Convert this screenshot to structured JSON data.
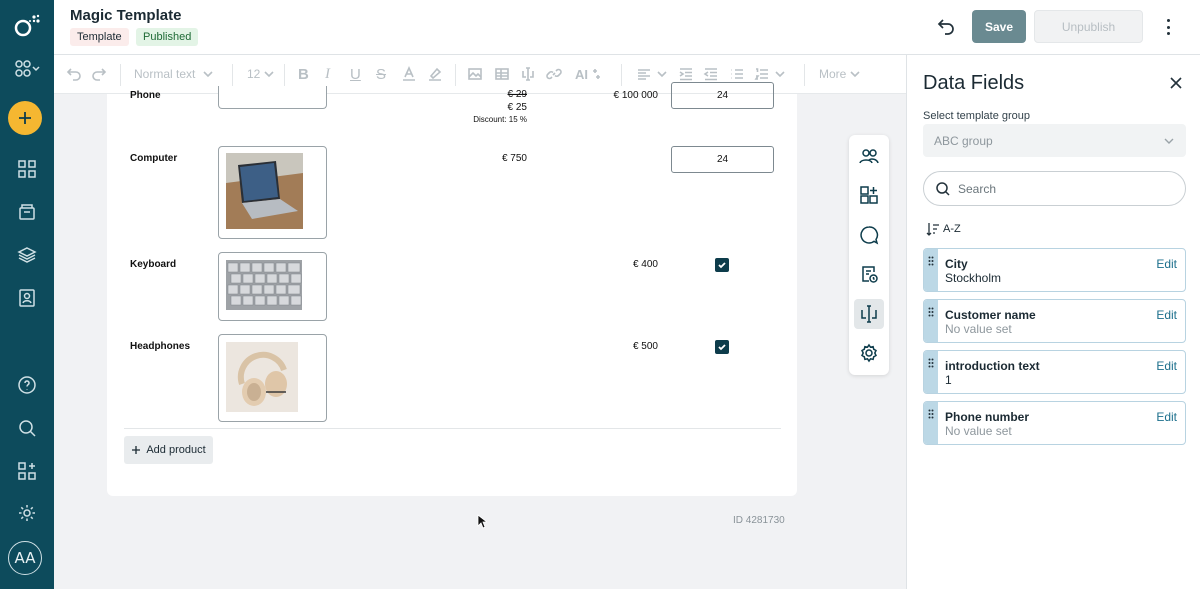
{
  "app": {
    "title": "Magic Template",
    "badges": [
      "Template",
      "Published"
    ]
  },
  "header": {
    "save_label": "Save",
    "unpublish_label": "Unpublish"
  },
  "nav": {
    "avatar_initials": "AA",
    "icons": [
      "logo-icon",
      "apps-switcher-icon",
      "add-icon",
      "dashboard-icon",
      "documents-icon",
      "layers-icon",
      "contacts-icon",
      "help-icon",
      "search-icon",
      "integrations-icon",
      "settings-icon"
    ]
  },
  "toolbar": {
    "style_label": "Normal text",
    "font_size": "12",
    "more_label": "More"
  },
  "document": {
    "products": [
      {
        "name": "Phone",
        "prices": [
          "€ 29",
          "€ 25"
        ],
        "discount": "Discount: 15 %",
        "total": "€ 100 000",
        "qty": "24"
      },
      {
        "name": "Computer",
        "price": "€ 750",
        "qty": "24"
      },
      {
        "name": "Keyboard",
        "total": "€ 400",
        "checked": true
      },
      {
        "name": "Headphones",
        "total": "€ 500",
        "checked": true
      }
    ],
    "add_product_label": "Add product",
    "doc_id": "ID 4281730"
  },
  "panel": {
    "title": "Data Fields",
    "group_label": "Select template group",
    "group_value": "ABC group",
    "search_placeholder": "Search",
    "sort_label": "A-Z",
    "fields": [
      {
        "name": "City",
        "value": "Stockholm",
        "edit": "Edit"
      },
      {
        "name": "Customer name",
        "value": "No value set",
        "edit": "Edit"
      },
      {
        "name": "introduction text",
        "value": "1",
        "edit": "Edit"
      },
      {
        "name": "Phone number",
        "value": "No value set",
        "edit": "Edit"
      }
    ]
  }
}
